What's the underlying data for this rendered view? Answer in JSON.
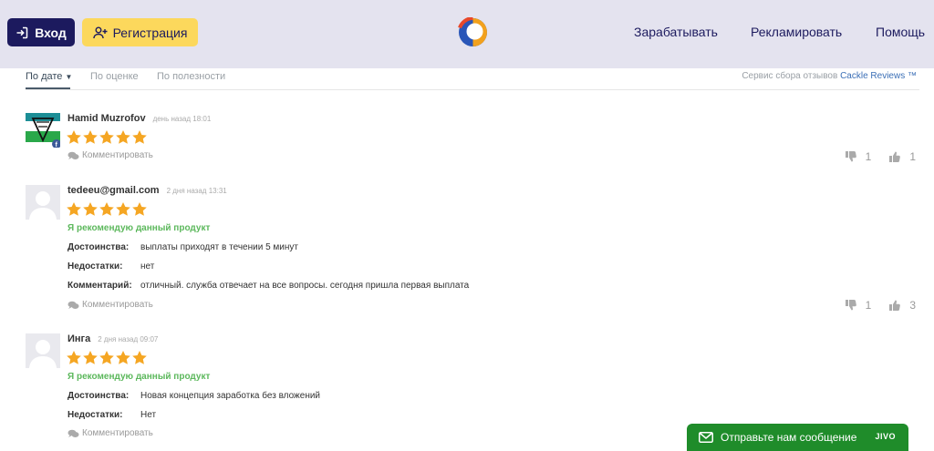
{
  "header": {
    "login_label": "Вход",
    "register_label": "Регистрация",
    "nav": [
      "Зарабатывать",
      "Рекламировать",
      "Помощь"
    ],
    "colors": {
      "header_bg": "#e4e3ef",
      "brand_dark": "#1c1a5e",
      "brand_yellow": "#fcd85c"
    }
  },
  "tabs": {
    "items": [
      "По дате",
      "По оценке",
      "По полезности"
    ],
    "active_index": 0,
    "service_prefix": "Сервис сбора отзывов",
    "service_link": "Cackle Reviews ™"
  },
  "reviews": [
    {
      "author": "Hamid Muzrofov",
      "date": "день назад 18:01",
      "rating": 5,
      "comment_label": "Комментировать",
      "dislikes": "1",
      "likes": "1"
    },
    {
      "author": "tedeeu@gmail.com",
      "date": "2 дня назад 13:31",
      "rating": 5,
      "recommend": "Я рекомендую данный продукт",
      "fields": [
        {
          "label": "Достоинства:",
          "value": "выплаты приходят в течении 5 минут"
        },
        {
          "label": "Недостатки:",
          "value": "нет"
        },
        {
          "label": "Комментарий:",
          "value": "отличный. служба отвечает на все вопросы. сегодня пришла первая выплата"
        }
      ],
      "comment_label": "Комментировать",
      "dislikes": "1",
      "likes": "3"
    },
    {
      "author": "Инга",
      "date": "2 дня назад 09:07",
      "rating": 5,
      "recommend": "Я рекомендую данный продукт",
      "fields": [
        {
          "label": "Достоинства:",
          "value": "Новая концепция заработка без вложений"
        },
        {
          "label": "Недостатки:",
          "value": "Нет"
        }
      ],
      "comment_label": "Комментировать"
    }
  ],
  "chat": {
    "label": "Отправьте нам сообщение",
    "brand": "JIVO",
    "color": "#1f8c2a"
  },
  "icons": {
    "star": "star-icon",
    "login": "login-icon",
    "register": "add-user-icon",
    "comment": "speech-bubble-icon",
    "dislike": "thumbs-down-icon",
    "like": "thumbs-up-icon",
    "mail": "mail-icon"
  }
}
